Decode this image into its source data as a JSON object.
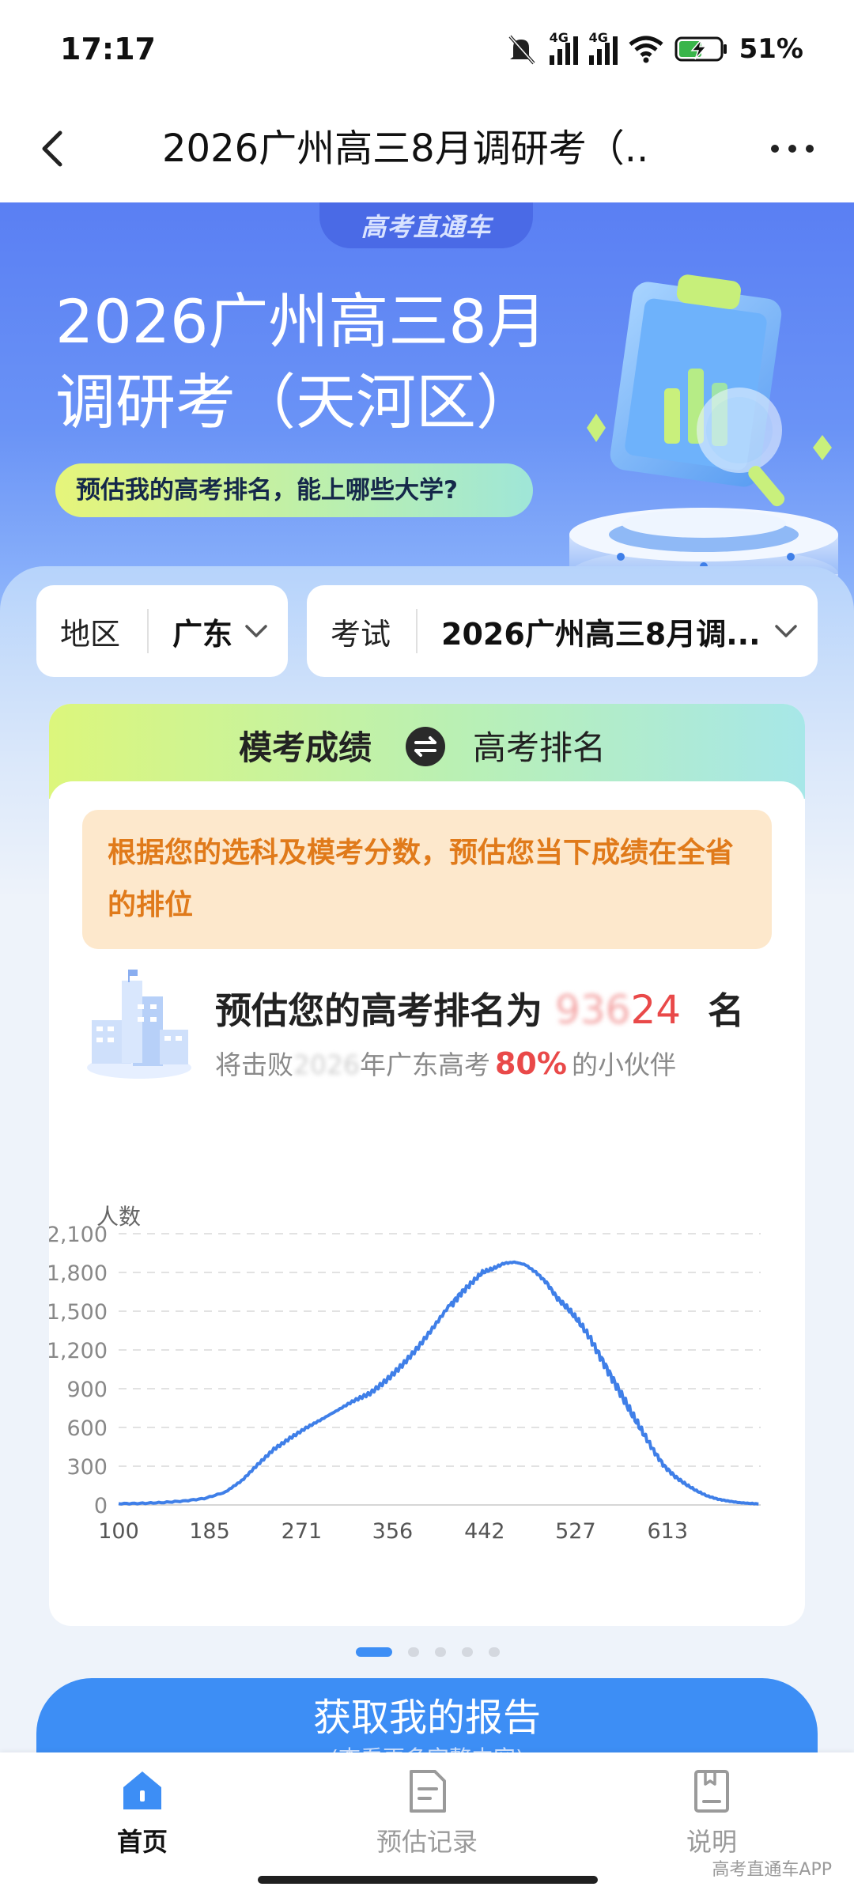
{
  "status_bar": {
    "time": "17:17",
    "network_a": "4G",
    "network_b": "4G",
    "battery": "51%",
    "icons": [
      "bell-muted-icon",
      "signal-icon",
      "signal-icon",
      "wifi-icon",
      "battery-charging-icon"
    ]
  },
  "header": {
    "title": "2026广州高三8月调研考（..",
    "back_icon": "chevron-left-icon",
    "more_icon": "more-horizontal-icon"
  },
  "hero": {
    "brand": "高考直通车",
    "title_line1": "2026广州高三8月",
    "title_line2": "调研考（天河区）",
    "pill_text": "预估我的高考排名，能上哪些大学?"
  },
  "filters": {
    "region_label": "地区",
    "region_value": "广东",
    "exam_label": "考试",
    "exam_value": "2026广州高三8月调..."
  },
  "card": {
    "tab_left": "模考成绩",
    "tab_right": "高考排名",
    "notice": "根据您的选科及模考分数，预估您当下成绩在全省的排位",
    "rank_prefix": "预估您的高考排名为",
    "rank_hidden": "936",
    "rank_visible": "24",
    "rank_unit": "名",
    "sub_prefix": "将击败",
    "sub_hidden": "2026",
    "sub_middle": "年广东高考",
    "sub_percent": "80%",
    "sub_suffix": "的小伙伴"
  },
  "chart_data": {
    "type": "line",
    "ylabel": "人数",
    "y_ticks": [
      0,
      300,
      600,
      900,
      1200,
      1500,
      1800,
      2100
    ],
    "y_tick_labels": [
      "0",
      "300",
      "600",
      "900",
      "1,200",
      "1,500",
      "1,800",
      "2,100"
    ],
    "x_tick_labels": [
      "100",
      "185",
      "271",
      "356",
      "442",
      "527",
      "613"
    ],
    "xlim": [
      100,
      700
    ],
    "ylim": [
      0,
      2100
    ],
    "grid": true,
    "color": "#3f7fe8",
    "series": [
      {
        "x": [
          100,
          120,
          140,
          160,
          180,
          200,
          215,
          230,
          245,
          260,
          275,
          290,
          305,
          320,
          335,
          350,
          365,
          380,
          395,
          410,
          420,
          430,
          440,
          450,
          460,
          470,
          480,
          490,
          500,
          510,
          520,
          530,
          540,
          550,
          560,
          570,
          580,
          590,
          600,
          610,
          620,
          630,
          640,
          650,
          660,
          670,
          680,
          690,
          698
        ],
        "values": [
          10,
          12,
          18,
          30,
          50,
          100,
          190,
          320,
          440,
          520,
          590,
          650,
          720,
          800,
          870,
          980,
          1100,
          1230,
          1380,
          1540,
          1640,
          1720,
          1800,
          1830,
          1870,
          1880,
          1860,
          1800,
          1720,
          1600,
          1520,
          1420,
          1300,
          1150,
          1000,
          850,
          700,
          560,
          420,
          300,
          220,
          160,
          110,
          70,
          45,
          30,
          18,
          12,
          8
        ]
      }
    ]
  },
  "pager": {
    "count": 5,
    "active": 0
  },
  "cta": {
    "main": "获取我的报告",
    "sub": "(查看更多完整内容)"
  },
  "bottom_nav": {
    "items": [
      {
        "label": "首页",
        "icon": "home-icon",
        "active": true
      },
      {
        "label": "预估记录",
        "icon": "document-icon",
        "active": false
      },
      {
        "label": "说明",
        "icon": "book-icon",
        "active": false
      }
    ],
    "active_color": "#3d8ef5",
    "inactive_color": "#9a9a9a"
  },
  "watermark": "高考直通车APP"
}
